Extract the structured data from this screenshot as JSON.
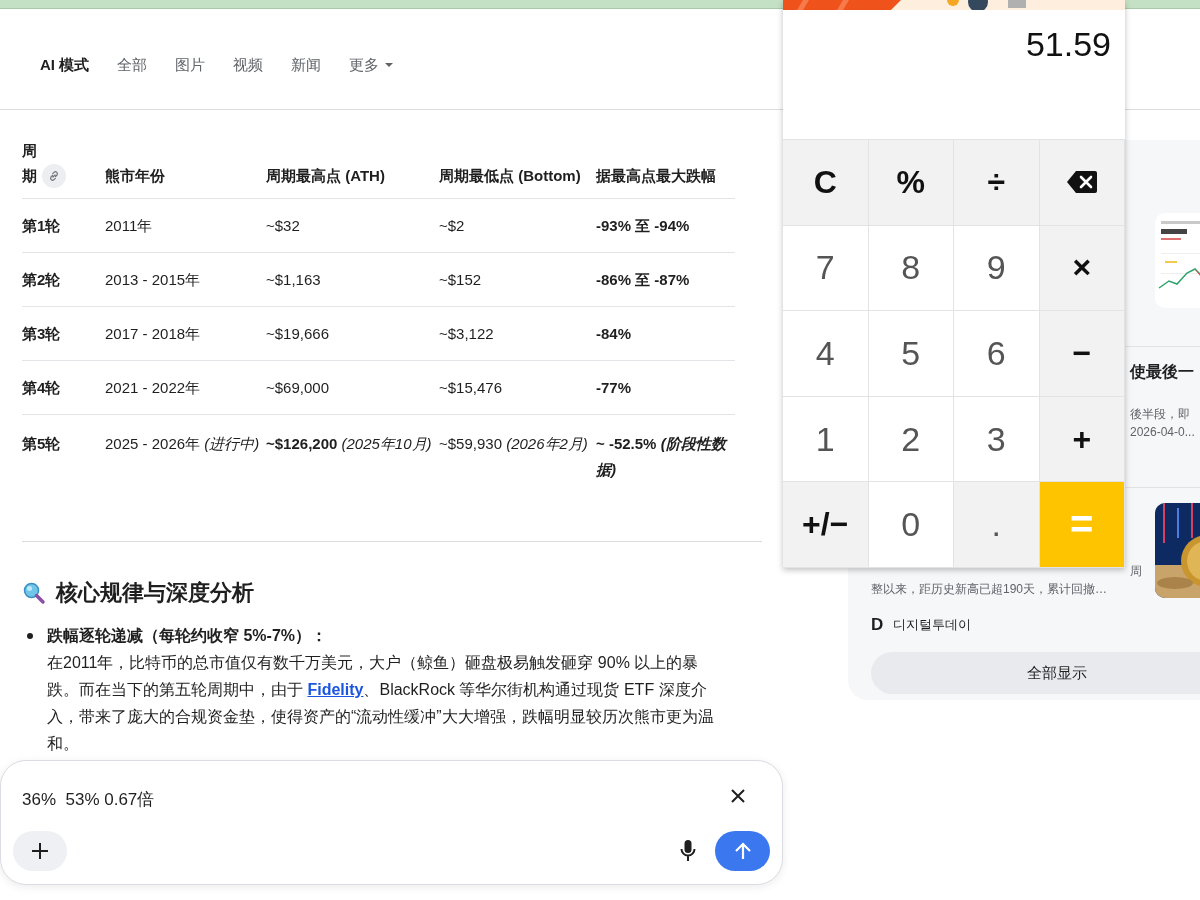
{
  "tabs": [
    {
      "label": "AI 模式",
      "selected": true,
      "kind": "tab"
    },
    {
      "label": "全部",
      "selected": false,
      "kind": "tab"
    },
    {
      "label": "图片",
      "selected": false,
      "kind": "tab"
    },
    {
      "label": "视频",
      "selected": false,
      "kind": "tab"
    },
    {
      "label": "新闻",
      "selected": false,
      "kind": "tab"
    },
    {
      "label": "更多",
      "selected": false,
      "kind": "menu"
    }
  ],
  "table": {
    "columns": [
      "周期",
      "熊市年份",
      "周期最高点 (ATH)",
      "周期最低点 (Bottom)",
      "据最高点最大跌幅"
    ],
    "rows": [
      [
        "第1轮",
        "2011年",
        "~$32",
        "~$2",
        "-93% 至 -94%"
      ],
      [
        "第2轮",
        "2013 - 2015年",
        "~$1,163",
        "~$152",
        "-86% 至 -87%"
      ],
      [
        "第3轮",
        "2017 - 2018年",
        "~$19,666",
        "~$3,122",
        "-84%"
      ],
      [
        "第4轮",
        "2021 - 2022年",
        "~$69,000",
        "~$15,476",
        "-77%"
      ],
      [
        "第5轮",
        "2025 - 2026年 *(进行中)*",
        "**~$126,200** *(2025年10月)*",
        "~$59,930 *(2026年2月)*",
        "~ -52.5% *(阶段性数据)*"
      ]
    ]
  },
  "article": {
    "heading": "核心规律与深度分析",
    "bullets": [
      {
        "title": "跌幅逐轮递减（每轮约收窄 5%-7%）：",
        "text_before": "在2011年，比特币的总市值仅有数千万美元，大户（鲸鱼）砸盘极易触发砸穿 90% 以上的暴跌。而在当下的第五轮周期中，由于 ",
        "link": "Fidelity",
        "text_after": "、BlackRock 等华尔街机构通过现货 ETF 深度介入，带来了庞大的合规资金垫，使得资产的“流动性缓冲”大大增强，跌幅明显较历次熊市更为温和。"
      }
    ]
  },
  "news": {
    "cards": [
      {
        "picture": true
      },
      {
        "picture": false,
        "lines": [
          {
            "kind": "title-tail",
            "text": "使最後一"
          },
          {
            "kind": "text-tail",
            "text": "後半段，即"
          },
          {
            "kind": "text-tail",
            "text": "2026-04-0..."
          }
        ]
      },
      {
        "picture": true,
        "lines": [
          {
            "kind": "text-tail",
            "text": "周"
          },
          {
            "kind": "text",
            "text": "整以来，距历史新高已超190天，累计回撤…"
          }
        ],
        "source": {
          "logo": "D",
          "name": "디지털투데이"
        }
      }
    ],
    "button": "全部显示"
  },
  "calculator": {
    "display": "51.59",
    "keys": [
      {
        "kind": "op",
        "label": "C"
      },
      {
        "kind": "op",
        "label": "%"
      },
      {
        "kind": "op",
        "label": "÷"
      },
      {
        "kind": "backspace"
      },
      {
        "kind": "digit",
        "label": "7"
      },
      {
        "kind": "digit",
        "label": "8"
      },
      {
        "kind": "digit",
        "label": "9"
      },
      {
        "kind": "op",
        "label": "×"
      },
      {
        "kind": "digit",
        "label": "4"
      },
      {
        "kind": "digit",
        "label": "5"
      },
      {
        "kind": "digit",
        "label": "6"
      },
      {
        "kind": "op",
        "label": "−"
      },
      {
        "kind": "digit",
        "label": "1"
      },
      {
        "kind": "digit",
        "label": "2"
      },
      {
        "kind": "digit",
        "label": "3"
      },
      {
        "kind": "op",
        "label": "+"
      },
      {
        "kind": "op",
        "label": "+/−"
      },
      {
        "kind": "digit",
        "label": "0"
      },
      {
        "kind": "point",
        "label": "."
      },
      {
        "kind": "equals",
        "label": "="
      }
    ]
  },
  "composer": {
    "value": "36%  53% 0.67倍"
  }
}
